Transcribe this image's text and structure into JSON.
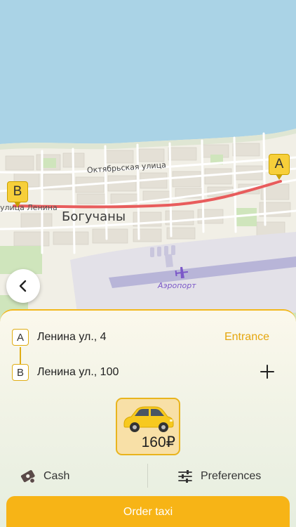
{
  "map": {
    "street_label": "Октябрьская улица",
    "lenina_label": "улица Ленина",
    "city_label": "Богучаны",
    "airport_label": "Аэропорт",
    "pin_a": "A",
    "pin_b": "B",
    "back_icon": "chevron-left-icon"
  },
  "route": {
    "from": {
      "letter": "A",
      "address": "Ленина ул., 4",
      "action": "Entrance"
    },
    "to": {
      "letter": "B",
      "address": "Ленина ул., 100",
      "action_icon": "plus-icon"
    }
  },
  "tariff": {
    "price": "160₽",
    "icon": "taxi-car-icon",
    "color": "#f7c91e"
  },
  "payment": {
    "method": "Cash",
    "icon": "cash-icon"
  },
  "preferences": {
    "label": "Preferences",
    "icon": "sliders-icon"
  },
  "order_button": {
    "label": "Order taxi",
    "color": "#f7b416"
  },
  "colors": {
    "accent": "#f2b81d",
    "route_line": "#e85c5c",
    "water": "#a9d4e6"
  }
}
